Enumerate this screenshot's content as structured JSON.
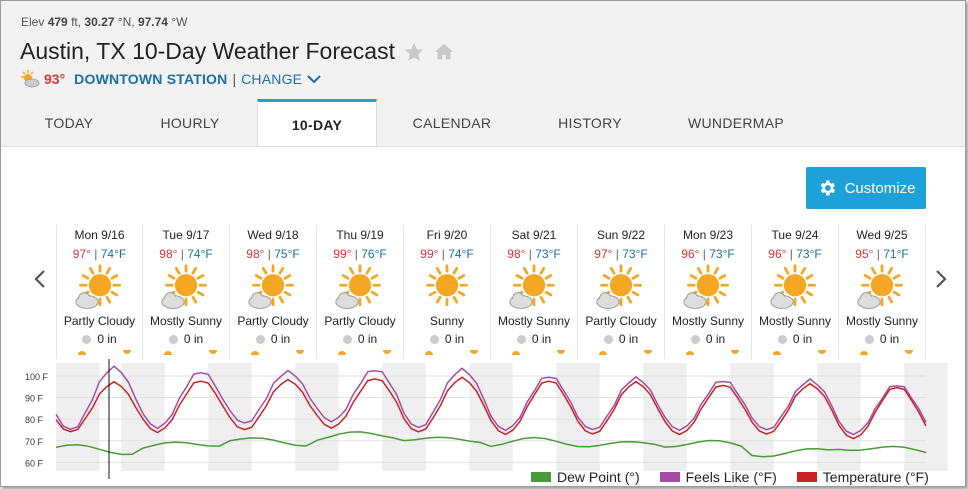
{
  "location": {
    "elev_label": "Elev",
    "elev_value": "479",
    "elev_unit": "ft,",
    "lat": "30.27",
    "lat_unit": "°N,",
    "lon": "97.74",
    "lon_unit": "°W",
    "title": "Austin, TX 10-Day Weather Forecast"
  },
  "station": {
    "current_temp": "93°",
    "name": "DOWNTOWN STATION",
    "separator": "|",
    "change_label": "CHANGE"
  },
  "tabs": [
    {
      "label": "TODAY",
      "active": false
    },
    {
      "label": "HOURLY",
      "active": false
    },
    {
      "label": "10-DAY",
      "active": true
    },
    {
      "label": "CALENDAR",
      "active": false
    },
    {
      "label": "HISTORY",
      "active": false
    },
    {
      "label": "WUNDERMAP",
      "active": false
    }
  ],
  "customize_label": "Customize",
  "days": [
    {
      "date": "Mon 9/16",
      "hi": "97°",
      "lo": "74°F",
      "cond": "Partly Cloudy",
      "icon": "partly-cloudy",
      "precip": "0 in"
    },
    {
      "date": "Tue 9/17",
      "hi": "98°",
      "lo": "74°F",
      "cond": "Mostly Sunny",
      "icon": "mostly-sunny",
      "precip": "0 in"
    },
    {
      "date": "Wed 9/18",
      "hi": "98°",
      "lo": "75°F",
      "cond": "Partly Cloudy",
      "icon": "partly-cloudy",
      "precip": "0 in"
    },
    {
      "date": "Thu 9/19",
      "hi": "99°",
      "lo": "76°F",
      "cond": "Partly Cloudy",
      "icon": "partly-cloudy",
      "precip": "0 in"
    },
    {
      "date": "Fri 9/20",
      "hi": "99°",
      "lo": "74°F",
      "cond": "Sunny",
      "icon": "sunny",
      "precip": "0 in"
    },
    {
      "date": "Sat 9/21",
      "hi": "98°",
      "lo": "73°F",
      "cond": "Mostly Sunny",
      "icon": "mostly-sunny",
      "precip": "0 in"
    },
    {
      "date": "Sun 9/22",
      "hi": "97°",
      "lo": "73°F",
      "cond": "Partly Cloudy",
      "icon": "partly-cloudy",
      "precip": "0 in"
    },
    {
      "date": "Mon 9/23",
      "hi": "96°",
      "lo": "73°F",
      "cond": "Mostly Sunny",
      "icon": "mostly-sunny",
      "precip": "0 in"
    },
    {
      "date": "Tue 9/24",
      "hi": "96°",
      "lo": "73°F",
      "cond": "Mostly Sunny",
      "icon": "mostly-sunny",
      "precip": "0 in"
    },
    {
      "date": "Wed 9/25",
      "hi": "95°",
      "lo": "71°F",
      "cond": "Mostly Sunny",
      "icon": "mostly-sunny",
      "precip": "0 in"
    }
  ],
  "chart_data": {
    "type": "line",
    "y_ticks": [
      "100 F",
      "90 F",
      "80 F",
      "70 F",
      "60 F"
    ],
    "ylim": [
      56,
      106
    ],
    "x": [
      "Mon 9/16",
      "Tue 9/17",
      "Wed 9/18",
      "Thu 9/19",
      "Fri 9/20",
      "Sat 9/21",
      "Sun 9/22",
      "Mon 9/23",
      "Tue 9/24",
      "Wed 9/25"
    ],
    "series": [
      {
        "name": "Dew Point (°)",
        "color": "#4a9a3a",
        "daily_values": [
          66,
          68,
          70,
          72,
          71,
          69,
          69,
          68,
          65,
          66
        ]
      },
      {
        "name": "Feels Like (°F)",
        "color": "#a64ca6",
        "highs": [
          104,
          102,
          102,
          103,
          103,
          100,
          99,
          98,
          98,
          96
        ],
        "lows": [
          75,
          76,
          78,
          79,
          76,
          75,
          75,
          75,
          75,
          73
        ]
      },
      {
        "name": "Temperature (°F)",
        "color": "#cc2222",
        "highs": [
          97,
          98,
          98,
          99,
          99,
          98,
          97,
          96,
          96,
          95
        ],
        "lows": [
          74,
          74,
          75,
          76,
          74,
          73,
          73,
          73,
          73,
          71
        ]
      }
    ],
    "grid": true,
    "legend": "bottom-right"
  }
}
